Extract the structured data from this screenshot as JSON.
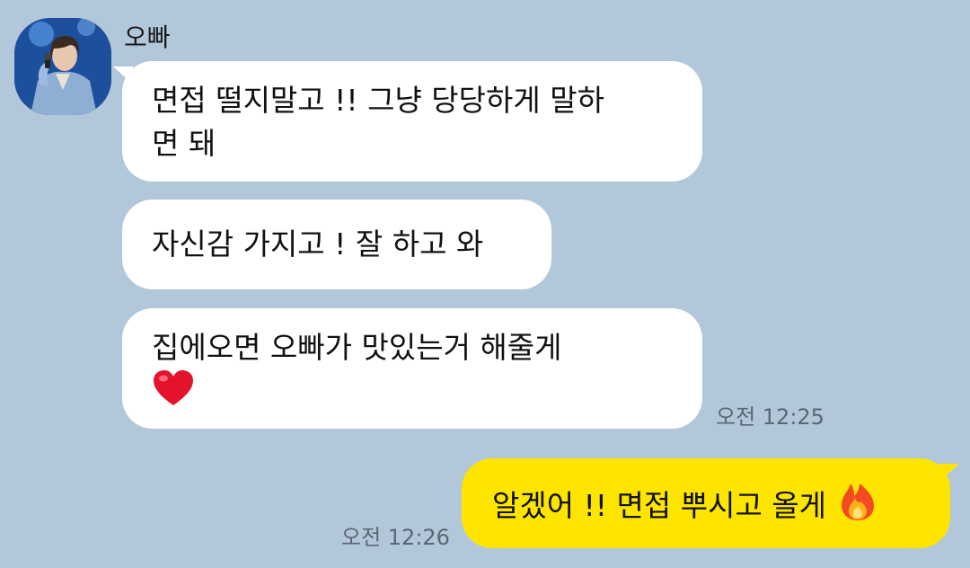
{
  "chat": {
    "sender": {
      "name": "오빠",
      "avatar": "profile-photo"
    },
    "messages": [
      {
        "from": "sender",
        "line1": "면접 떨지말고 !! 그냥 당당하게 말하",
        "line2": "면 돼",
        "time": ""
      },
      {
        "from": "sender",
        "line1": "자신감 가지고 ! 잘 하고 와",
        "time": ""
      },
      {
        "from": "sender",
        "line1": "집에오면 오빠가 맛있는거 해줄게",
        "emoji": "red-heart-icon",
        "time": "오전 12:25"
      },
      {
        "from": "me",
        "line1": "알겠어 !! 면접 뿌시고 올게",
        "emoji": "fire-icon",
        "time": "오전 12:26"
      }
    ]
  },
  "colors": {
    "background": "#b2c7da",
    "incoming_bubble": "#ffffff",
    "outgoing_bubble": "#fee500",
    "timestamp": "#5b6772"
  }
}
